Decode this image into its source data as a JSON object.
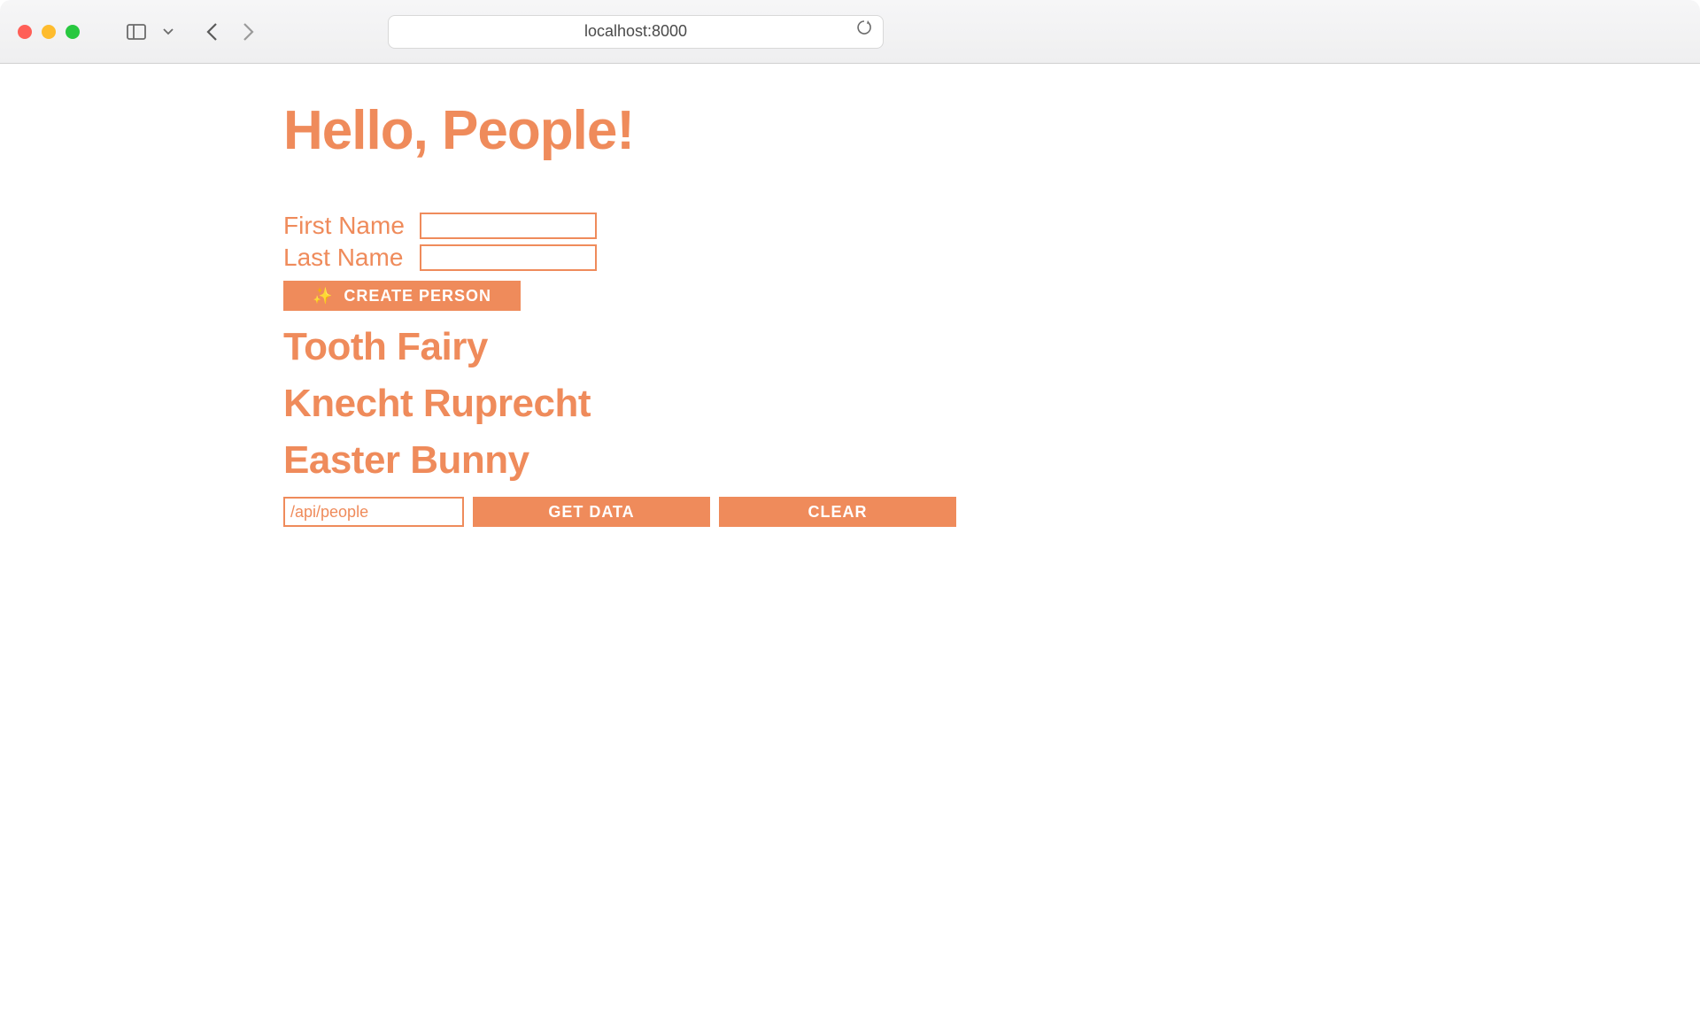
{
  "browser": {
    "address": "localhost:8000"
  },
  "page": {
    "title": "Hello, People!"
  },
  "form": {
    "first_name_label": "First Name",
    "last_name_label": "Last Name",
    "first_name_value": "",
    "last_name_value": "",
    "create_label": "CREATE PERSON",
    "sparkle_icon": "✨"
  },
  "people": [
    {
      "name": "Tooth Fairy"
    },
    {
      "name": "Knecht Ruprecht"
    },
    {
      "name": "Easter Bunny"
    }
  ],
  "api": {
    "endpoint_value": "/api/people",
    "get_data_label": "GET DATA",
    "clear_label": "CLEAR"
  }
}
